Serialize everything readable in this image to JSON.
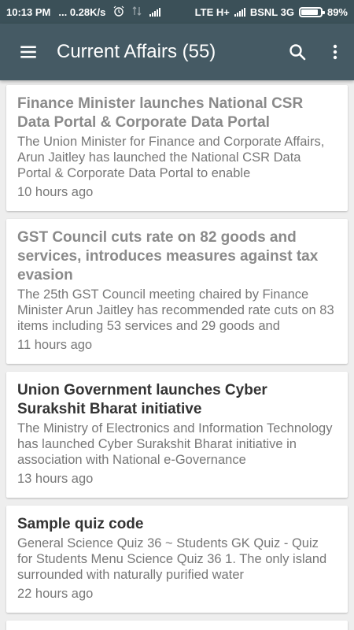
{
  "status_bar": {
    "time": "10:13 PM",
    "speed": "... 0.28K/s",
    "network1": "LTE H+",
    "network2": "BSNL 3G",
    "battery": "89%",
    "battery_level": 0.89,
    "icons": [
      "alarm-icon",
      "data-arrows-icon",
      "signal-icon",
      "signal-icon",
      "battery-icon"
    ]
  },
  "app_bar": {
    "title": "Current Affairs (55)",
    "icons": [
      "menu-icon",
      "search-icon",
      "more-vert-icon"
    ]
  },
  "articles": [
    {
      "title": "Finance Minister launches National CSR Data Portal & Corporate Data Portal",
      "desc": "The Union Minister for Finance and Corporate Affairs, Arun Jaitley has launched the National CSR Data Portal & Corporate Data Portal to enable",
      "time": "10 hours ago",
      "read": true
    },
    {
      "title": "GST Council cuts rate on 82 goods and services, introduces measures against tax evasion",
      "desc": "The 25th GST Council meeting chaired by Finance Minister Arun Jaitley has recommended rate cuts on 83 items including 53 services and 29 goods and",
      "time": "11 hours ago",
      "read": true
    },
    {
      "title": "Union Government launches Cyber Surakshit Bharat initiative",
      "desc": "The Ministry of Electronics and Information Technology has launched Cyber Surakshit Bharat initiative in association with National e-Governance",
      "time": "13 hours ago",
      "read": false
    },
    {
      "title": "Sample quiz code",
      "desc": "General Science Quiz 36 ~ Students GK Quiz - Quiz for Students Menu Science Quiz 36 1. The only island surrounded with naturally purified water",
      "time": "22 hours ago",
      "read": false
    }
  ]
}
